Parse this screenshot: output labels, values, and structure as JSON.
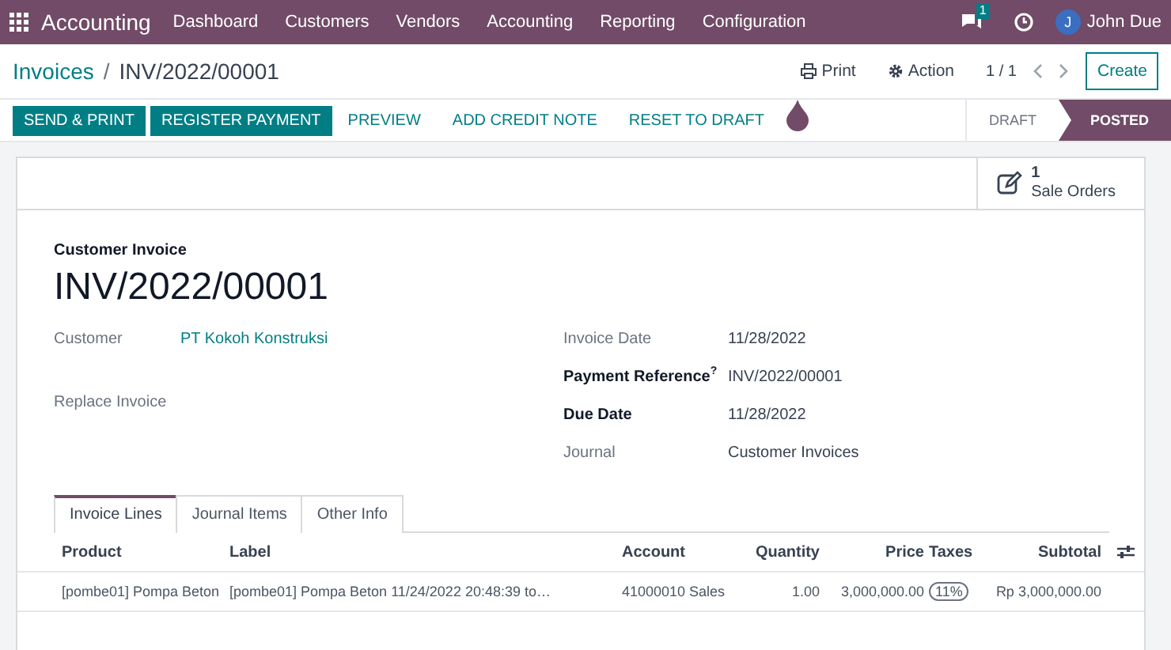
{
  "navbar": {
    "app": "Accounting",
    "menu": [
      "Dashboard",
      "Customers",
      "Vendors",
      "Accounting",
      "Reporting",
      "Configuration"
    ],
    "messages_badge": "1",
    "user": {
      "initial": "J",
      "name": "John Due"
    }
  },
  "control_panel": {
    "breadcrumb": [
      "Invoices",
      "INV/2022/00001"
    ],
    "breadcrumb_separator": "/",
    "actions": [
      {
        "kind": "print",
        "label": "Print"
      },
      {
        "kind": "gear",
        "label": "Action"
      }
    ],
    "pager": "1 / 1",
    "create": "Create"
  },
  "buttons": [
    {
      "label": "SEND & PRINT",
      "kind": "primary"
    },
    {
      "label": "REGISTER PAYMENT",
      "kind": "primary"
    },
    {
      "label": "PREVIEW",
      "kind": "link"
    },
    {
      "label": "ADD CREDIT NOTE",
      "kind": "link"
    },
    {
      "label": "RESET TO DRAFT",
      "kind": "link"
    }
  ],
  "statusbar": [
    {
      "label": "DRAFT",
      "selected": false
    },
    {
      "label": "POSTED",
      "selected": true
    }
  ],
  "smart_button": {
    "count": "1",
    "label": "Sale Orders"
  },
  "form": {
    "subtitle": "Customer Invoice",
    "title": "INV/2022/00001",
    "left_fields": [
      {
        "label": "Customer",
        "value": "PT Kokoh Konstruksi",
        "bold": false
      },
      {
        "label": "Replace Invoice",
        "bold": false
      }
    ],
    "right_fields": [
      {
        "label": "Invoice Date",
        "value": "11/28/2022",
        "bold": false
      },
      {
        "label": "Payment Reference$^{?}$",
        "value": "INV/2022/00001",
        "bold": true
      },
      {
        "label": "Due Date",
        "value": "11/28/2022",
        "bold": true
      },
      {
        "label": "Journal",
        "value": "Customer Invoices",
        "bold": false
      }
    ]
  },
  "tabs": [
    {
      "label": "Invoice Lines",
      "selected": true
    },
    {
      "label": "Journal Items",
      "selected": false
    },
    {
      "label": "Other Info",
      "selected": false
    }
  ],
  "table": {
    "columns": [
      "Product",
      "Label",
      "Account",
      "Quantity",
      "Price",
      "Taxes",
      "Subtotal"
    ],
    "rows": [
      {
        "cells": [
          "[pombe01] Pompa Beton",
          "[pombe01] Pompa Beton 11/24/2022 20:48:39 to…",
          "41000010 Sales",
          "1.00",
          "3,000,000.00",
          "11%",
          "Rp 3,000,000.00"
        ]
      }
    ]
  }
}
